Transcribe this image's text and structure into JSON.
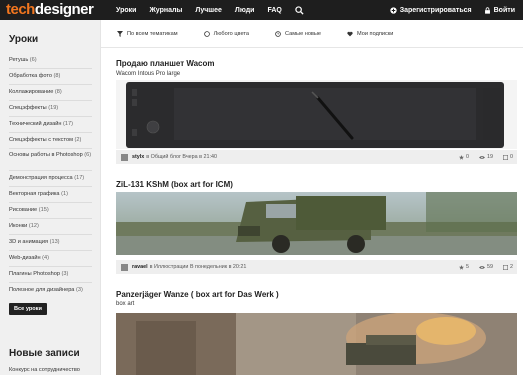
{
  "header": {
    "logo_part1": "tech",
    "logo_part2": "designer",
    "nav": [
      "Уроки",
      "Журналы",
      "Лучшее",
      "Люди",
      "FAQ"
    ],
    "register": "Зарегистрироваться",
    "login": "Войти"
  },
  "sidebar": {
    "title": "Уроки",
    "categories": [
      {
        "label": "Ретушь",
        "count": "(6)"
      },
      {
        "label": "Обработка фото",
        "count": "(8)"
      },
      {
        "label": "Коллажирование",
        "count": "(8)"
      },
      {
        "label": "Спецэффекты",
        "count": "(19)"
      },
      {
        "label": "Технический дизайн",
        "count": "(17)"
      },
      {
        "label": "Спецэффекты с текстом",
        "count": "(2)"
      },
      {
        "label": "Основы работы в Photoshop",
        "count": "(6)"
      },
      {
        "label": "Демонстрация процесса",
        "count": "(17)"
      },
      {
        "label": "Векторная графика",
        "count": "(1)"
      },
      {
        "label": "Рисование",
        "count": "(15)"
      },
      {
        "label": "Иконки",
        "count": "(12)"
      },
      {
        "label": "3D и анимация",
        "count": "(13)"
      },
      {
        "label": "Web-дизайн",
        "count": "(4)"
      },
      {
        "label": "Плагины Photoshop",
        "count": "(3)"
      },
      {
        "label": "Полезное для дизайнера",
        "count": "(3)"
      }
    ],
    "all_button": "Все уроки",
    "new_title": "Новые записи",
    "new_entry": "Конкурс на сотрудничество"
  },
  "filters": [
    "По всем тематикам",
    "Любого цвета",
    "Самые новые",
    "Мои подписки"
  ],
  "posts": [
    {
      "title": "Продаю планшет Wacom",
      "subtitle": "Wacom Intous Pro large",
      "author": "stylx",
      "blog": "в Общий блог",
      "time": "Вчера в 21:40",
      "stars": "0",
      "views": "19",
      "comments": "0"
    },
    {
      "title": "ZiL-131 KShM (box art for ICM)",
      "subtitle": "",
      "author": "ravael",
      "blog": "в Иллюстрации",
      "time": "В понедельник в 20:21",
      "stars": "5",
      "views": "59",
      "comments": "2"
    },
    {
      "title": "Panzerjäger Wanze ( box art for Das Werk )",
      "subtitle": "box art"
    }
  ]
}
